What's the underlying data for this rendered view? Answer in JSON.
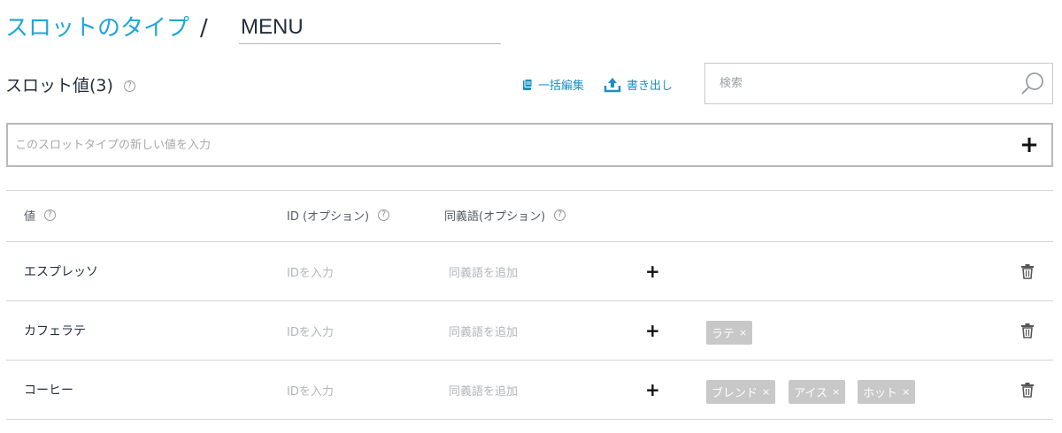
{
  "header": {
    "breadcrumb_link": "スロットのタイプ",
    "separator": "/",
    "slot_type_name": "MENU"
  },
  "slot_values": {
    "heading": "スロット値(3)",
    "help": "?",
    "bulk_edit_label": "一括編集",
    "export_label": "書き出し",
    "search_placeholder": "検索",
    "new_value_placeholder": "このスロットタイプの新しい値を入力",
    "add_symbol": "+"
  },
  "table": {
    "columns": [
      "値",
      "ID (オプション)",
      "同義語(オプション)"
    ],
    "rows": [
      {
        "value": "エスプレッソ",
        "id_placeholder": "IDを入力",
        "synonym_placeholder": "同義語を追加",
        "add": "+",
        "synonyms": []
      },
      {
        "value": "カフェラテ",
        "id_placeholder": "IDを入力",
        "synonym_placeholder": "同義語を追加",
        "add": "+",
        "synonyms": [
          "ラテ"
        ]
      },
      {
        "value": "コーヒー",
        "id_placeholder": "IDを入力",
        "synonym_placeholder": "同義語を追加",
        "add": "+",
        "synonyms": [
          "ブレンド",
          "アイス",
          "ホット"
        ]
      }
    ]
  },
  "tag_remove_symbol": "×",
  "colors": {
    "link": "#1ea7d6",
    "action": "#1a8fc4",
    "tag_bg": "#c8c8c8"
  }
}
